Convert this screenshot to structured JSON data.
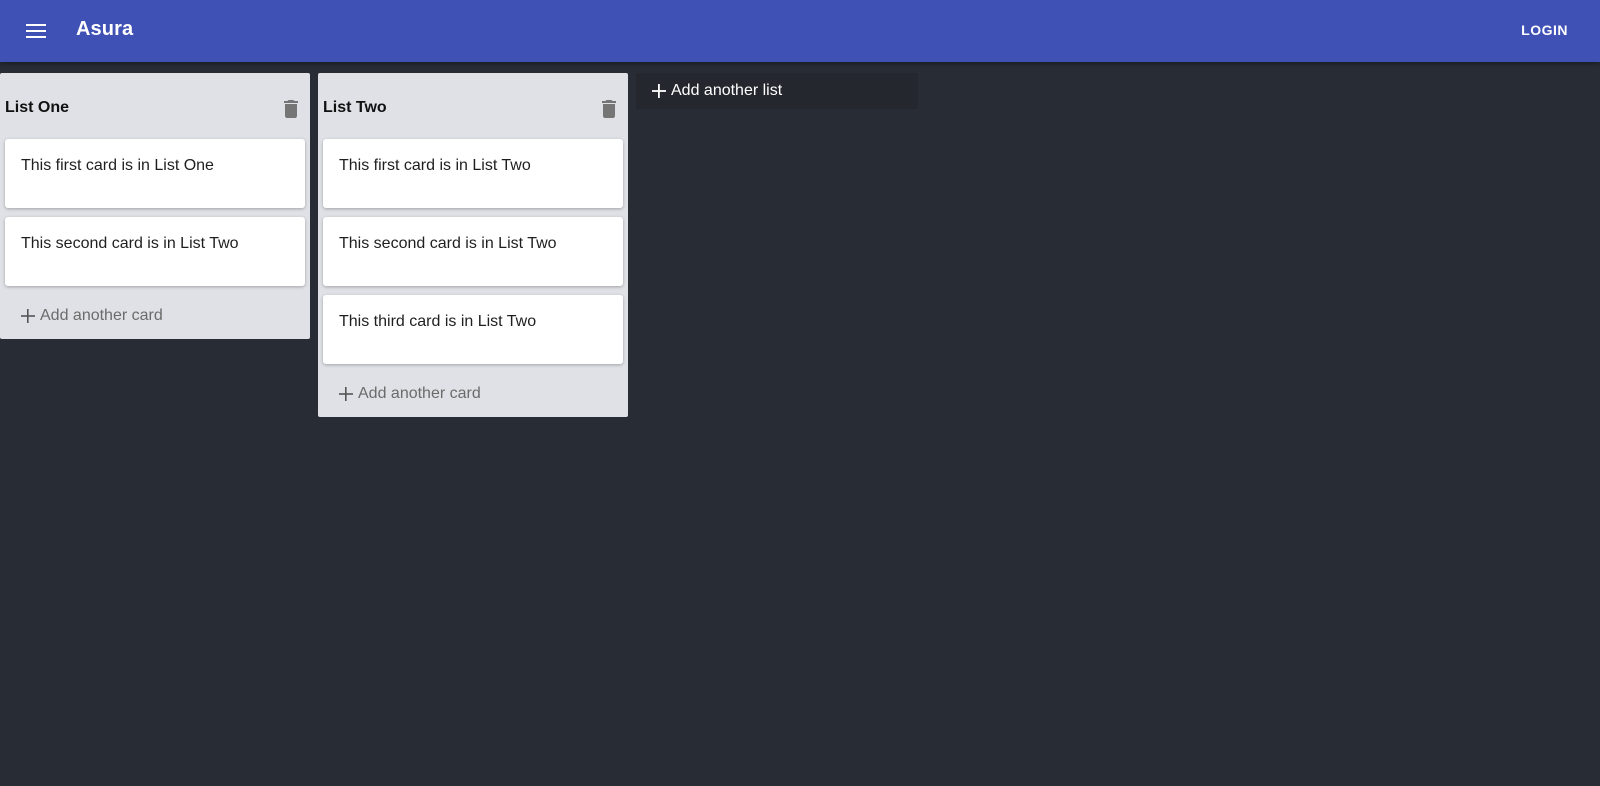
{
  "appbar": {
    "title": "Asura",
    "menu_icon": "menu-icon",
    "login_label": "LOGIN",
    "color": "#3f51b5"
  },
  "board": {
    "background": "#282c34",
    "lists": [
      {
        "title": "List One",
        "cards": [
          {
            "text": "This first card is in List One"
          },
          {
            "text": "This second card is in List Two"
          }
        ],
        "add_card_label": "Add another card"
      },
      {
        "title": "List Two",
        "cards": [
          {
            "text": "This first card is in List Two"
          },
          {
            "text": "This second card is in List Two"
          },
          {
            "text": "This third card is in List Two"
          }
        ],
        "add_card_label": "Add another card"
      }
    ],
    "add_list_label": "Add another list"
  },
  "icons": {
    "delete": "trash-icon",
    "add": "plus-icon"
  }
}
